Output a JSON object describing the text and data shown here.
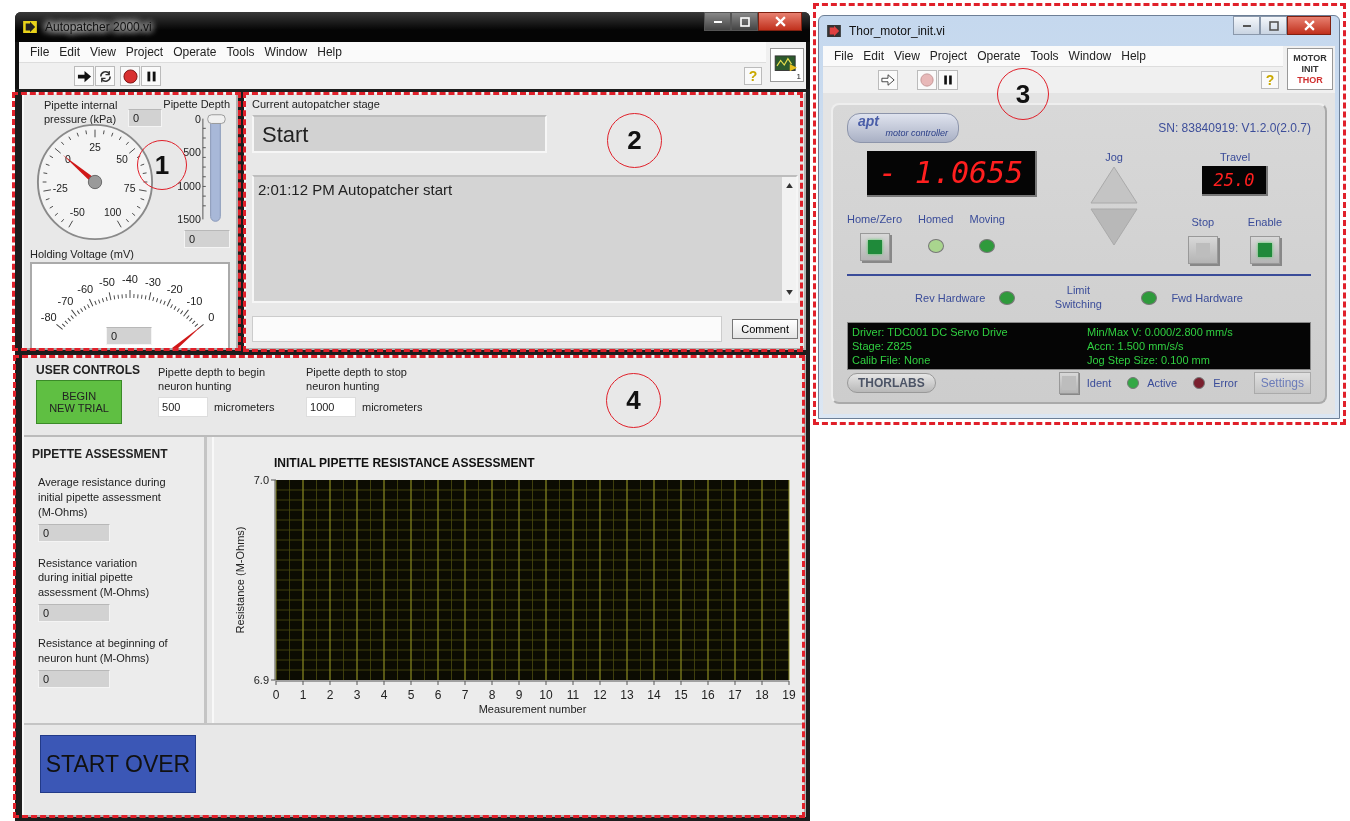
{
  "annotations": [
    {
      "number": "1"
    },
    {
      "number": "2"
    },
    {
      "number": "3"
    },
    {
      "number": "4"
    }
  ],
  "main_window": {
    "title": "Autopatcher 2000.vi",
    "menu": [
      "File",
      "Edit",
      "View",
      "Project",
      "Operate",
      "Tools",
      "Window",
      "Help"
    ],
    "help": "?",
    "vi_icon_text": "1",
    "pressure": {
      "label": "Pipette internal pressure (kPa)",
      "value": "0",
      "scale": [
        "-50",
        "-25",
        "0",
        "25",
        "50",
        "75",
        "100"
      ]
    },
    "depth": {
      "label": "Pipette Depth",
      "scale": [
        "0",
        "500",
        "1000",
        "1500"
      ],
      "value": "0"
    },
    "voltage": {
      "label": "Holding Voltage (mV)",
      "scale": [
        "-80",
        "-70",
        "-60",
        "-50",
        "-40",
        "-30",
        "-20",
        "-10",
        "0"
      ],
      "value": "0"
    },
    "stage": {
      "label": "Current autopatcher stage",
      "value": "Start"
    },
    "log": {
      "lines": [
        "2:01:12 PM Autopatcher start"
      ]
    },
    "comment": {
      "button": "Comment"
    },
    "user_controls": {
      "title": "USER CONTROLS",
      "button": "BEGIN NEW TRIAL",
      "fields": [
        {
          "label": "Pipette depth to begin neuron hunting",
          "value": "500",
          "unit": "micrometers"
        },
        {
          "label": "Pipette depth to stop neuron hunting",
          "value": "1000",
          "unit": "micrometers"
        }
      ]
    },
    "assessment": {
      "title": "PIPETTE ASSESSMENT",
      "fields": [
        {
          "label": "Average resistance during initial pipette assessment (M-Ohms)",
          "value": "0"
        },
        {
          "label": "Resistance variation during initial pipette assessment (M-Ohms)",
          "value": "0"
        },
        {
          "label": "Resistance at beginning of neuron hunt (M-Ohms)",
          "value": "0"
        }
      ]
    },
    "chart": {
      "chart_data": {
        "type": "line",
        "title": "INITIAL PIPETTE RESISTANCE ASSESSMENT",
        "xlabel": "Measurement number",
        "ylabel": "Resistance (M-Ohms)",
        "grid": true,
        "xlim": [
          0,
          19
        ],
        "ylim": [
          6.9,
          7.0
        ],
        "xticks": [
          0,
          1,
          2,
          3,
          4,
          5,
          6,
          7,
          8,
          9,
          10,
          11,
          12,
          13,
          14,
          15,
          16,
          17,
          18,
          19
        ],
        "yticks": [
          {
            "value": 6.9,
            "label": "6.9"
          },
          {
            "value": 7.0,
            "label": "7.0"
          }
        ]
      }
    },
    "start_over": "START OVER"
  },
  "motor_window": {
    "title": "Thor_motor_init.vi",
    "menu": [
      "File",
      "Edit",
      "View",
      "Project",
      "Operate",
      "Tools",
      "Window",
      "Help"
    ],
    "help": "?",
    "vi_icon_text": [
      "MOTOR",
      "INIT",
      "THOR"
    ],
    "logo": {
      "name": "apt",
      "sub": "motor controller"
    },
    "serial": "SN: 83840919: V1.2.0(2.0.7)",
    "position": "- 1.0655",
    "jog": "Jog",
    "travel": {
      "label": "Travel",
      "value": "25.0"
    },
    "left_controls": [
      {
        "kind": "button",
        "label": "Home/Zero",
        "on": true
      },
      {
        "kind": "led",
        "label": "Homed",
        "color": "#a9d58e"
      },
      {
        "kind": "led",
        "label": "Moving",
        "color": "#2f9a3c"
      }
    ],
    "right_controls": [
      {
        "kind": "button",
        "label": "Stop",
        "on": false
      },
      {
        "kind": "button",
        "label": "Enable",
        "on": true
      }
    ],
    "limits": {
      "label": "Limit Switching",
      "items": [
        {
          "label": "Rev Hardware",
          "color": "#2f9a3c"
        },
        {
          "label": "Fwd Hardware",
          "color": "#2f9a3c"
        }
      ]
    },
    "info": {
      "left": [
        "Driver: TDC001 DC Servo Drive",
        "Stage: Z825",
        "Calib File: None"
      ],
      "right": [
        "Min/Max V: 0.000/2.800 mm/s",
        "Accn: 1.500 mm/s/s",
        "Jog Step Size: 0.100 mm"
      ]
    },
    "brand": "THORLABS",
    "footer": [
      {
        "kind": "button",
        "label": "Ident",
        "on": false
      },
      {
        "kind": "led",
        "label": "Active",
        "color": "#33a845"
      },
      {
        "kind": "led",
        "label": "Error",
        "color": "#7a1f2e"
      }
    ],
    "settings": "Settings"
  }
}
